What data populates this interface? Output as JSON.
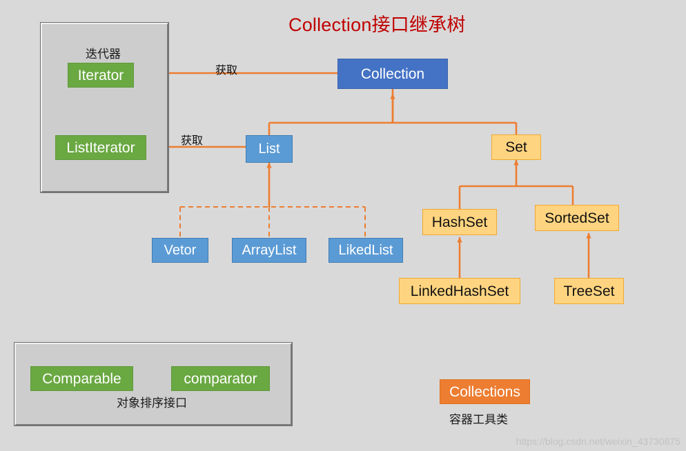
{
  "title": "Collection接口继承树",
  "theme": {
    "background": "#d9d9d9",
    "title_color": "#c00000",
    "connector_color": "#ed7d31",
    "green": "#6aa842",
    "blue_dark": "#4472c4",
    "blue_light": "#5b9bd5",
    "amber": "#ffd480",
    "orange": "#ed7d31",
    "frame_fill": "#cdcdcd"
  },
  "iterator_group": {
    "label": "迭代器",
    "nodes": [
      {
        "label": "Iterator",
        "color": "green"
      },
      {
        "label": "ListIterator",
        "color": "green"
      }
    ]
  },
  "tree": {
    "root": {
      "label": "Collection",
      "color": "blue_dark"
    },
    "list": {
      "label": "List",
      "color": "blue_light"
    },
    "set": {
      "label": "Set",
      "color": "amber"
    },
    "list_children": [
      {
        "label": "Vetor",
        "color": "blue_light"
      },
      {
        "label": "ArrayList",
        "color": "blue_light"
      },
      {
        "label": "LikedList",
        "color": "blue_light"
      }
    ],
    "set_children": [
      {
        "label": "HashSet",
        "color": "amber"
      },
      {
        "label": "SortedSet",
        "color": "amber"
      }
    ],
    "hashset_child": {
      "label": "LinkedHashSet",
      "color": "amber"
    },
    "sortedset_child": {
      "label": "TreeSet",
      "color": "amber"
    }
  },
  "edge_labels": {
    "collection_to_iterator": "获取",
    "list_to_listiterator": "获取"
  },
  "comparator_group": {
    "caption": "对象排序接口",
    "nodes": [
      {
        "label": "Comparable",
        "color": "green"
      },
      {
        "label": "comparator",
        "color": "green"
      }
    ]
  },
  "collections_util": {
    "label": "Collections",
    "caption": "容器工具类"
  },
  "watermark": "https://blog.csdn.net/weixin_43730875"
}
